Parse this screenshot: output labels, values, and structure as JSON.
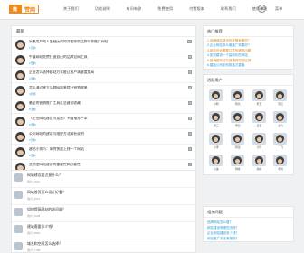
{
  "logo": {
    "mark": "微",
    "text": "赞网"
  },
  "nav": [
    "关于我们",
    "功能说明",
    "有问有答",
    "免费使用",
    "付费版本",
    "联系我们",
    "使用帮助"
  ],
  "header": {
    "menu": "菜单"
  },
  "feed": {
    "title": "最新",
    "items": [
      {
        "title": "采集用户的人生经历如何才能帮助品牌写作推广网站",
        "meta": "1天前",
        "count": "12"
      },
      {
        "title": "牛逼网站免费打造自己的品牌官网工具",
        "meta": "2天前",
        "count": "8"
      },
      {
        "title": "企业怎么选择建站方式能让客户满意度提高",
        "meta": "3天前",
        "count": "5"
      },
      {
        "title": "怎么通过建立品牌网站来提升营销效果",
        "meta": "4天前",
        "count": "6"
      },
      {
        "title": "最全的营销推广工具汇总建议收藏",
        "meta": "5天前",
        "count": "9"
      },
      {
        "title": "《企业网站建设与运营》书籍推荐一本",
        "meta": "6天前",
        "count": "3"
      },
      {
        "title": "公司网站的建设与维护方法解析说明",
        "meta": "7天前",
        "count": "4"
      },
      {
        "title": "建站小技巧：如何快速上线一个网站",
        "meta": "8天前",
        "count": "2"
      },
      {
        "title": "营销型网站建设的重要性和必要性",
        "meta": "9天前",
        "count": "7"
      }
    ]
  },
  "qa": {
    "items": [
      {
        "q": "网站建设要注意什么？",
        "user": "用户_2021"
      },
      {
        "q": "网站首页怎么设计好看？",
        "user": "用户_3012"
      },
      {
        "q": "如何提高网站的访问量？",
        "user": "用户_1108"
      },
      {
        "q": "建站需要多少钱？",
        "user": "用户_5520"
      },
      {
        "q": "域名和空间怎么选择？",
        "user": "用户_7788"
      }
    ]
  },
  "sidebar": {
    "hot_title": "热门推荐",
    "hot": [
      "1.品牌网站建设的步骤有哪些？",
      "2.企业网站怎么做推广效果好？",
      "3.网站优化需要注意的细节问题",
      "4.如何建设一个高转化的网站",
      "5.营销型网站与普通网站的区别",
      "6.建站公司如何挑选才靠谱",
      "7.网站内容更新频率多少合适"
    ],
    "members_title": "活跃用户",
    "members": [
      "小明",
      "阿杰",
      "老王",
      "晓红",
      "张三",
      "李四",
      "王五",
      "赵六",
      "小李",
      "阿强",
      "大伟",
      "飞飞",
      "小美",
      "阿峰",
      "静静",
      "老刘"
    ],
    "links_title": "相关问题",
    "links": [
      "品牌网站怎么做？",
      "网站建设有哪些流程？",
      "企业网站建设多少钱？",
      "网站推广方法有哪些？"
    ]
  }
}
